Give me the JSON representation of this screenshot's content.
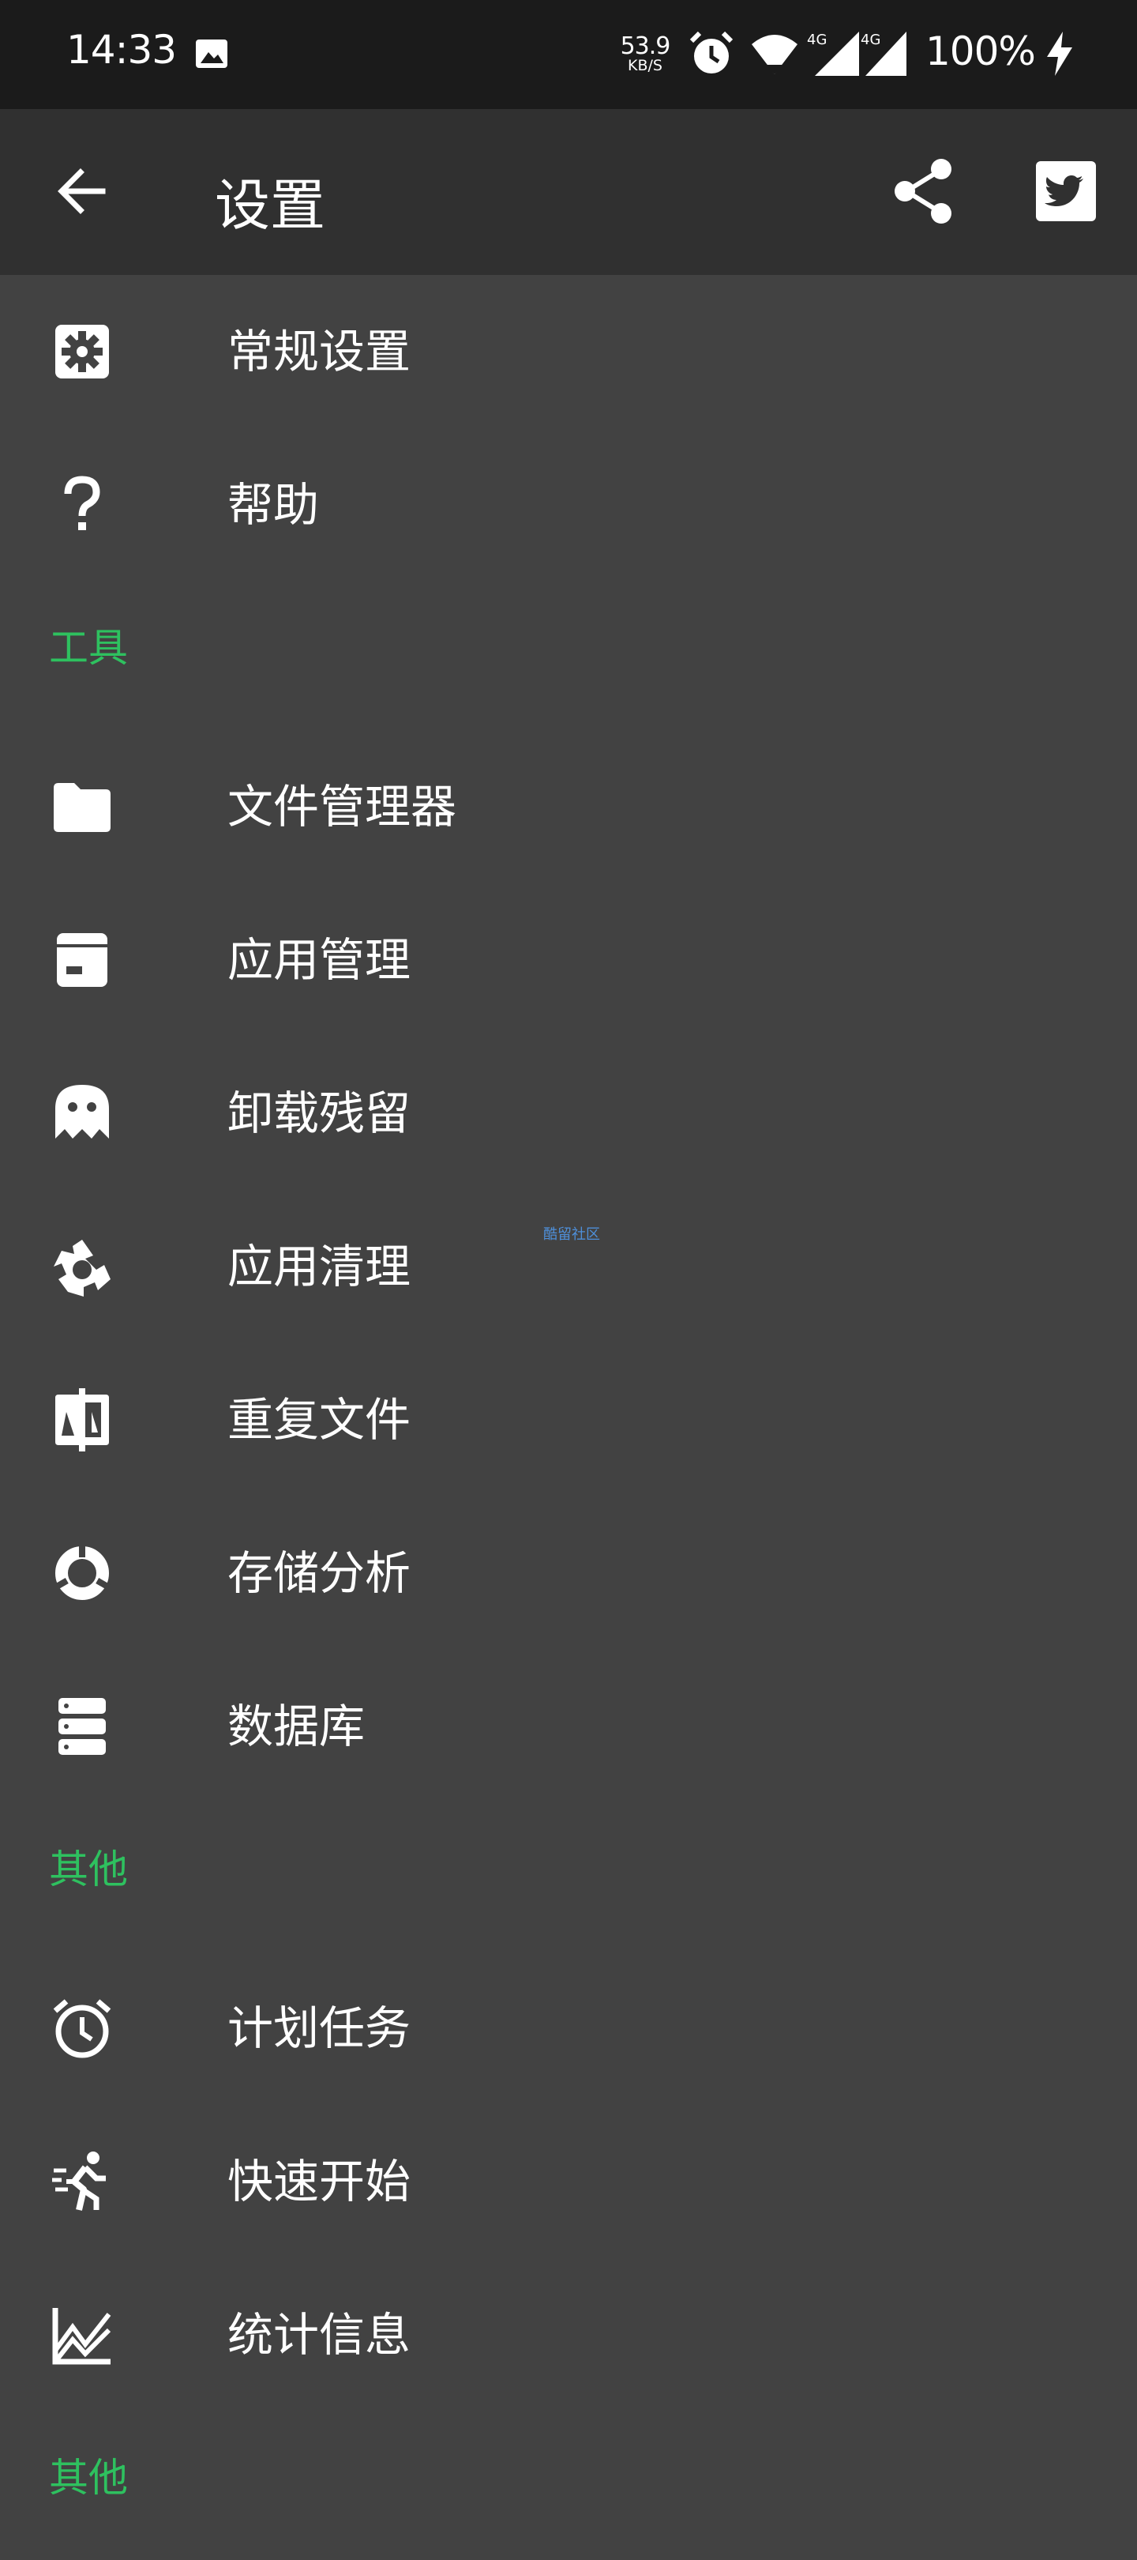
{
  "status_bar": {
    "time": "14:33",
    "speed_value": "53.9",
    "speed_unit": "KB/S",
    "network_1": "4G",
    "network_2": "4G",
    "battery": "100%"
  },
  "app_bar": {
    "title": "设置"
  },
  "menu": {
    "item_general": "常规设置",
    "item_help": "帮助",
    "section_tools": "工具",
    "item_file_manager": "文件管理器",
    "item_app_manager": "应用管理",
    "item_residue": "卸载残留",
    "item_app_cleaner": "应用清理",
    "item_duplicates": "重复文件",
    "item_storage": "存储分析",
    "item_database": "数据库",
    "section_other": "其他",
    "item_scheduler": "计划任务",
    "item_quickstart": "快速开始",
    "item_stats": "统计信息",
    "section_more": "其他"
  },
  "watermark": "酷留社区",
  "colors": {
    "background": "#424242",
    "app_bar": "#303030",
    "status_bar": "#1b1b1b",
    "accent": "#2ec15f"
  }
}
